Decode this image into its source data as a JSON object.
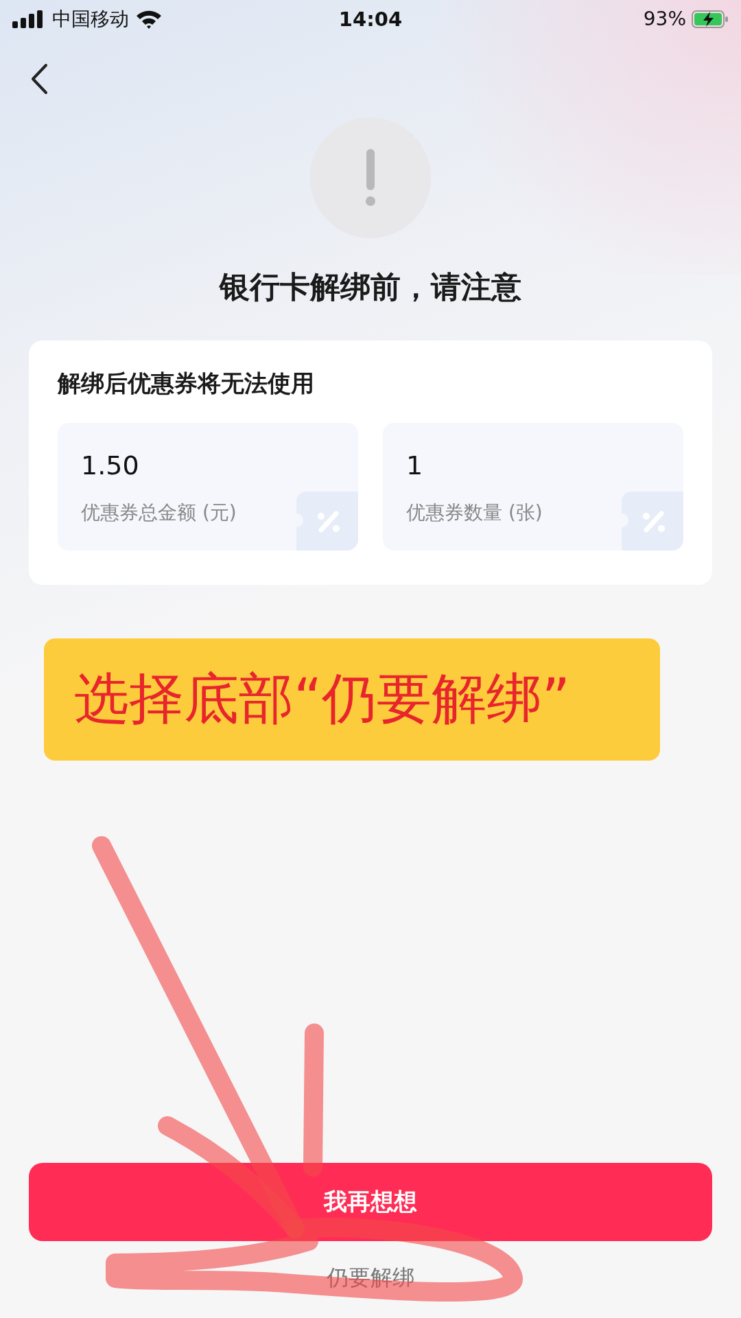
{
  "status_bar": {
    "carrier": "中国移动",
    "time": "14:04",
    "battery": "93%"
  },
  "title": "银行卡解绑前，请注意",
  "notice_card": {
    "heading": "解绑后优惠券将无法使用",
    "stats": [
      {
        "value": "1.50",
        "label": "优惠券总金额 (元)"
      },
      {
        "value": "1",
        "label": "优惠券数量 (张)"
      }
    ]
  },
  "annotation": {
    "label": "选择底部“仍要解绑”"
  },
  "buttons": [
    {
      "kind": "primary",
      "label": "我再想想"
    },
    {
      "kind": "text",
      "label": "仍要解绑"
    }
  ]
}
